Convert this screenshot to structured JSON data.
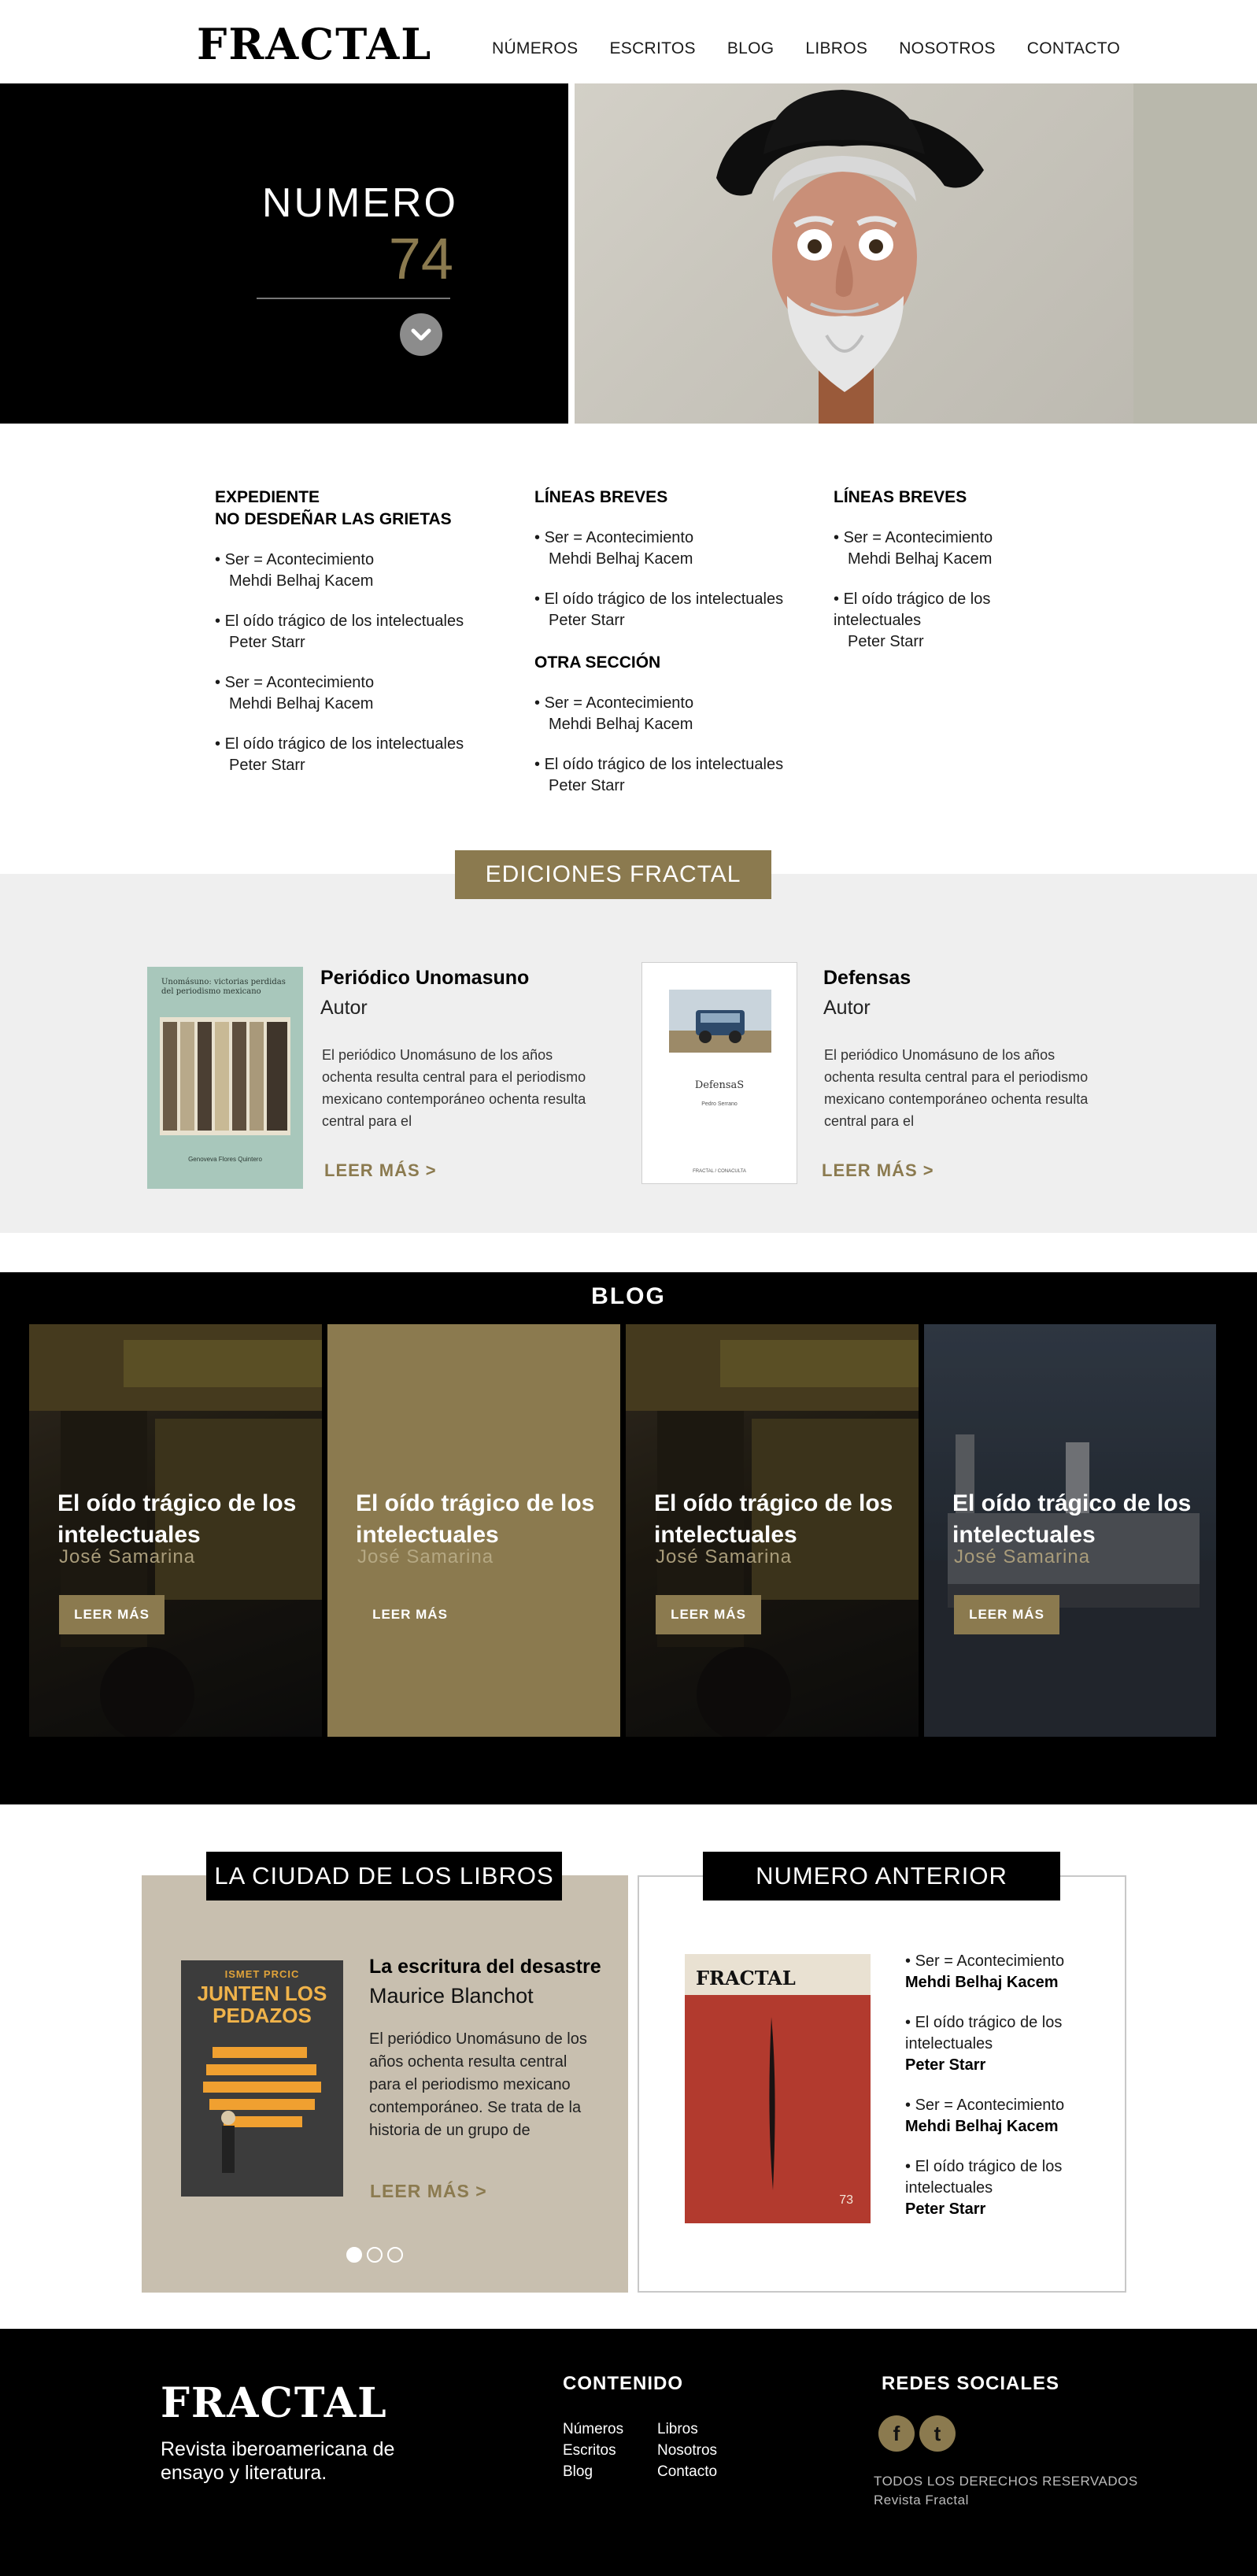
{
  "header": {
    "logo": "FRACTAL",
    "nav": [
      "NÚMEROS",
      "ESCRITOS",
      "BLOG",
      "LIBROS",
      "NOSOTROS",
      "CONTACTO"
    ]
  },
  "hero": {
    "title": "NUMERO",
    "number": "74"
  },
  "index": {
    "col1": {
      "heading1": "EXPEDIENTE",
      "heading2": "NO DESDEÑAR LAS GRIETAS",
      "items": [
        {
          "title": "Ser = Acontecimiento",
          "author": "Mehdi Belhaj Kacem"
        },
        {
          "title": "El oído trágico de los intelectuales",
          "author": "Peter Starr"
        },
        {
          "title": "Ser = Acontecimiento",
          "author": "Mehdi Belhaj Kacem"
        },
        {
          "title": "El oído trágico de los intelectuales",
          "author": "Peter Starr"
        }
      ]
    },
    "col2": {
      "heading": "LÍNEAS BREVES",
      "items": [
        {
          "title": "Ser = Acontecimiento",
          "author": "Mehdi Belhaj Kacem"
        },
        {
          "title": "El oído trágico de los intelectuales",
          "author": "Peter Starr"
        }
      ],
      "heading_b": "OTRA SECCIÓN",
      "items_b": [
        {
          "title": "Ser = Acontecimiento",
          "author": "Mehdi Belhaj Kacem"
        },
        {
          "title": "El oído trágico de los intelectuales",
          "author": "Peter Starr"
        }
      ]
    },
    "col3": {
      "heading": "LÍNEAS BREVES",
      "items": [
        {
          "title": "Ser = Acontecimiento",
          "author": "Mehdi Belhaj Kacem"
        },
        {
          "title": "El oído trágico de los intelectuales",
          "author": "Peter Starr"
        }
      ]
    }
  },
  "ediciones": {
    "heading": "EDICIONES FRACTAL",
    "books": [
      {
        "title": "Periódico Unomasuno",
        "author": "Autor",
        "desc": "El periódico Unomásuno de los años ochenta resulta central para el periodismo mexicano contemporáneo ochenta resulta central para el",
        "more": "LEER MÁS >",
        "cover_title": "Unomásuno: victorias perdidas del periodismo mexicano",
        "cover_author": "Genoveva Flores Quintero"
      },
      {
        "title": "Defensas",
        "author": "Autor",
        "desc": "El periódico Unomásuno de los años ochenta resulta central para el periodismo mexicano contemporáneo ochenta resulta central para el",
        "more": "LEER MÁS >",
        "cover_title": "DefensaS",
        "cover_author": "Pedro Serrano",
        "cover_pub": "FRACTAL / CONACULTA"
      }
    ]
  },
  "blog": {
    "heading": "BLOG",
    "cards": [
      {
        "title": "El oído trágico de los intelectuales",
        "author": "José Samarina",
        "button": "LEER MÁS"
      },
      {
        "title": "El oído trágico de los intelectuales",
        "author": "José Samarina",
        "button": "LEER MÁS"
      },
      {
        "title": "El oído trágico de los intelectuales",
        "author": "José Samarina",
        "button": "LEER MÁS"
      },
      {
        "title": "El oído trágico de los intelectuales",
        "author": "José Samarina",
        "button": "LEER MÁS"
      }
    ]
  },
  "ciudad": {
    "heading": "LA CIUDAD DE LOS LIBROS",
    "book_title": "La escritura del desastre",
    "book_author": "Maurice Blanchot",
    "desc": "El periódico Unomásuno de los años ochenta resulta central para el periodismo mexicano contemporáneo. Se trata de la historia de un grupo de",
    "more": "LEER MÁS >",
    "cover_author": "ISMET PRCIC",
    "cover_title": "JUNTEN LOS PEDAZOS",
    "slide_active": 1,
    "slide_count": 3
  },
  "anterior": {
    "heading": "NUMERO ANTERIOR",
    "cover_logo": "FRACTAL",
    "cover_number": "73",
    "items": [
      {
        "title": "Ser = Acontecimiento",
        "author": "Mehdi Belhaj Kacem"
      },
      {
        "title": "El oído trágico de los intelectuales",
        "author": "Peter Starr"
      },
      {
        "title": "Ser = Acontecimiento",
        "author": "Mehdi Belhaj Kacem"
      },
      {
        "title": "El oído trágico de los intelectuales",
        "author": "Peter Starr"
      }
    ]
  },
  "footer": {
    "logo": "FRACTAL",
    "tagline": "Revista iberoamericana de ensayo y literatura.",
    "contenido_heading": "CONTENIDO",
    "links_col1": [
      "Números",
      "Escritos",
      "Blog"
    ],
    "links_col2": [
      "Libros",
      "Nosotros",
      "Contacto"
    ],
    "redes_heading": "REDES SOCIALES",
    "social": [
      "f",
      "t"
    ],
    "copyright1": "TODOS LOS DERECHOS RESERVADOS",
    "copyright2": "Revista Fractal"
  },
  "colors": {
    "accent": "#8b7a4f",
    "sand": "#c8bfaf",
    "light_band": "#efefef"
  }
}
